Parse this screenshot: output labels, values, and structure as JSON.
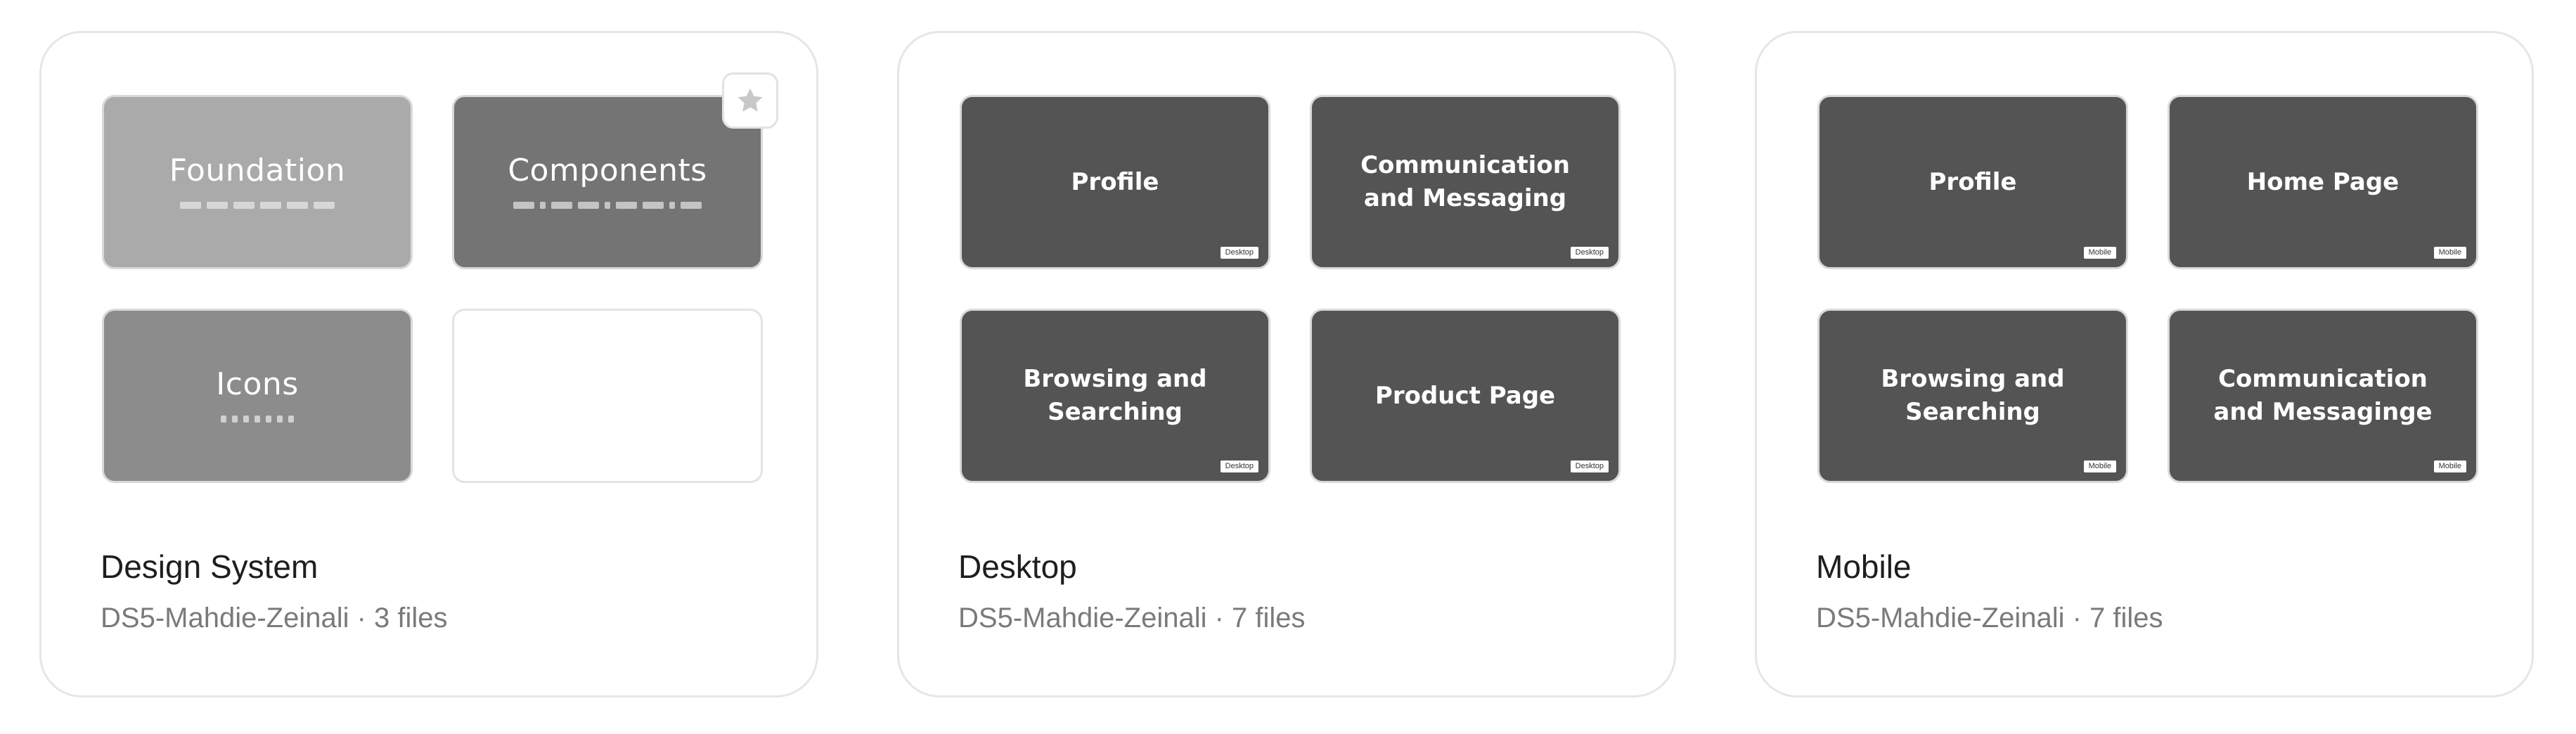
{
  "projects": [
    {
      "title": "Design System",
      "meta": "DS5-Mahdie-Zeinali · 3 files",
      "thumbnails": {
        "foundation": "Foundation",
        "components": "Components",
        "icons": "Icons"
      }
    },
    {
      "title": "Desktop",
      "meta": "DS5-Mahdie-Zeinali · 7 files",
      "thumbnails": [
        {
          "label": "Profile",
          "tag": "Desktop"
        },
        {
          "label": "Communication\nand Messaging",
          "tag": "Desktop"
        },
        {
          "label": "Browsing and\nSearching",
          "tag": "Desktop"
        },
        {
          "label": "Product Page",
          "tag": "Desktop"
        }
      ]
    },
    {
      "title": "Mobile",
      "meta": "DS5-Mahdie-Zeinali · 7 files",
      "thumbnails": [
        {
          "label": "Profile",
          "tag": "Mobile"
        },
        {
          "label": "Home Page",
          "tag": "Mobile"
        },
        {
          "label": "Browsing and\nSearching",
          "tag": "Mobile"
        },
        {
          "label": "Communication\nand Messaginge",
          "tag": "Mobile"
        }
      ]
    }
  ],
  "star_icon": "star-icon",
  "colors": {
    "dark_thumbnail": "#545454",
    "foundation": "#aaaaaa",
    "components": "#747474",
    "icons": "#8c8c8c"
  }
}
